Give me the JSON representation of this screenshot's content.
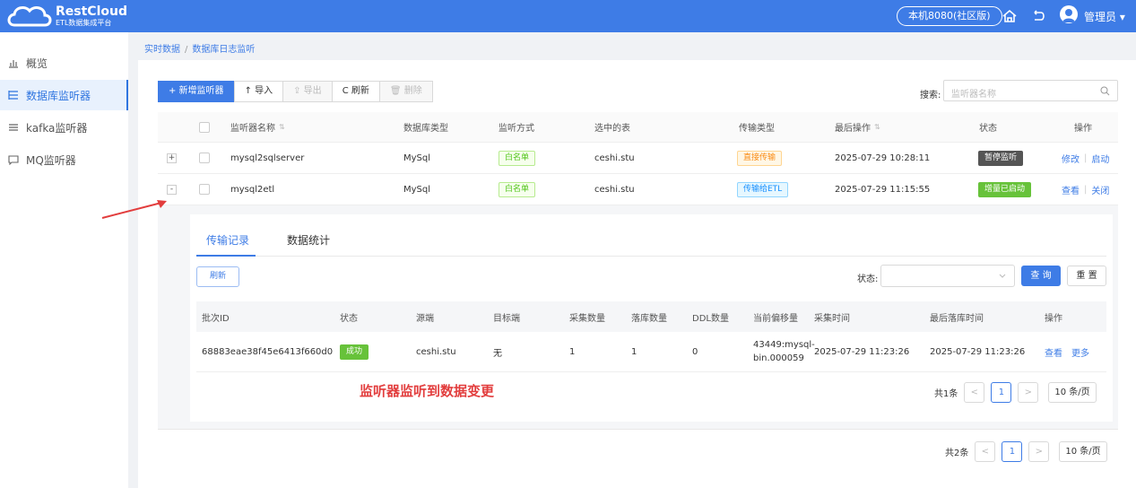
{
  "brand": {
    "title": "RestCloud",
    "subtitle": "ETL数据集成平台"
  },
  "header": {
    "server": "本机8080(社区版)",
    "user": "管理员 ▾"
  },
  "sidebar": {
    "items": [
      {
        "label": "概览",
        "icon": "bar-chart-icon"
      },
      {
        "label": "数据库监听器",
        "icon": "list-icon",
        "active": true
      },
      {
        "label": "kafka监听器",
        "icon": "stack-icon"
      },
      {
        "label": "MQ监听器",
        "icon": "message-icon"
      }
    ]
  },
  "breadcrumb": {
    "parent": "实时数据",
    "sep": "/",
    "current": "数据库日志监听"
  },
  "toolbar": {
    "add": "+ 新增监听器",
    "import": "↑ 导入",
    "export": "⇪ 导出",
    "refresh": "C 刷新",
    "delete": "🗑 删除"
  },
  "search": {
    "label": "搜索:",
    "placeholder": "监听器名称"
  },
  "listeners": {
    "columns": [
      "监听器名称",
      "数据库类型",
      "监听方式",
      "选中的表",
      "传输类型",
      "最后操作",
      "状态",
      "操作"
    ],
    "rows": [
      {
        "expander": "+",
        "name": "mysql2sqlserver",
        "db_type": "MySql",
        "mode": "白名单",
        "table": "ceshi.stu",
        "transfer": "直接传输",
        "last_op": "2025-07-29 10:28:11",
        "status": "暂停监听",
        "action1": "修改",
        "action2": "启动"
      },
      {
        "expander": "-",
        "name": "mysql2etl",
        "db_type": "MySql",
        "mode": "白名单",
        "table": "ceshi.stu",
        "transfer": "传输给ETL",
        "last_op": "2025-07-29 11:15:55",
        "status": "增量已启动",
        "action1": "查看",
        "action2": "关闭"
      }
    ]
  },
  "detail": {
    "tabs": [
      "传输记录",
      "数据统计"
    ],
    "refresh": "刷新",
    "status_label": "状态:",
    "status_value": "",
    "query": "查 询",
    "reset": "重 置",
    "columns": [
      "批次ID",
      "状态",
      "源端",
      "目标端",
      "采集数量",
      "落库数量",
      "DDL数量",
      "当前偏移量",
      "采集时间",
      "最后落库时间",
      "操作"
    ],
    "rows": [
      {
        "batch_id": "68883eae38f45e6413f660d0",
        "status": "成功",
        "source": "ceshi.stu",
        "target": "无",
        "collected": "1",
        "stored": "1",
        "ddl": "0",
        "offset_1": "43449:mysql-",
        "offset_2": "bin.000059",
        "collect_time": "2025-07-29 11:23:26",
        "store_time": "2025-07-29 11:23:26",
        "view": "查看",
        "more": "更多"
      }
    ],
    "pager": {
      "total": "共1条",
      "prev": "<",
      "page": "1",
      "next": ">",
      "size": "10 条/页"
    }
  },
  "annotation": "监听器监听到数据变更",
  "pager": {
    "total": "共2条",
    "prev": "<",
    "page": "1",
    "next": ">",
    "size": "10 条/页"
  },
  "colors": {
    "primary": "#3e7ce6",
    "annotation": "#e23d3d",
    "success": "#67c23a"
  }
}
